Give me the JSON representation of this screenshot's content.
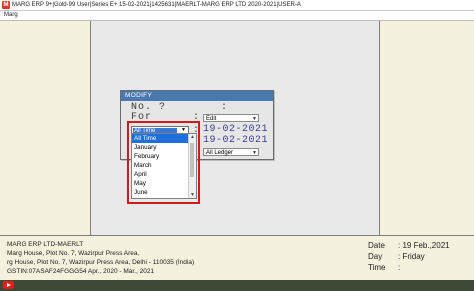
{
  "window": {
    "title": "MARG ERP 9+|Gold-99 User|Series E+ 15-02-2021|1425631|MAERLT-MARG ERP LTD 2020-2021|USER-A"
  },
  "menu": {
    "items": [
      "Marg"
    ]
  },
  "dialog": {
    "title": "MODIFY",
    "no_label": "No. ?",
    "for_label": "For",
    "type_value": "Edit",
    "date_from": "19-02-2021",
    "date_to": "19-02-2021",
    "ledger_value": "All Ledger",
    "period_selected": "All Time",
    "period_options": [
      "All Time",
      "January",
      "February",
      "March",
      "April",
      "May",
      "June"
    ]
  },
  "footer": {
    "company_lines": [
      "MARG ERP LTD-MAERLT",
      "Marg House, Plot No. 7, Wazirpur Press Area,",
      "rg House, Plot No. 7, Wazirpur Press Area, Delhi - 110035 (India)",
      "GSTIN:07ASAF24FGGG54  Apr., 2020 - Mar., 2021"
    ],
    "date_label": "Date",
    "date_value": ": 19 Feb.,2021",
    "day_label": "Day",
    "day_value": ": Friday",
    "time_label": "Time",
    "time_value": ":"
  },
  "colors": {
    "accent": "#4a78b2",
    "highlight": "#d11b1b",
    "panel": "#f4f1dc"
  },
  "icons": [
    "app-icon",
    "youtube-icon",
    "dropdown-arrow-icon"
  ]
}
